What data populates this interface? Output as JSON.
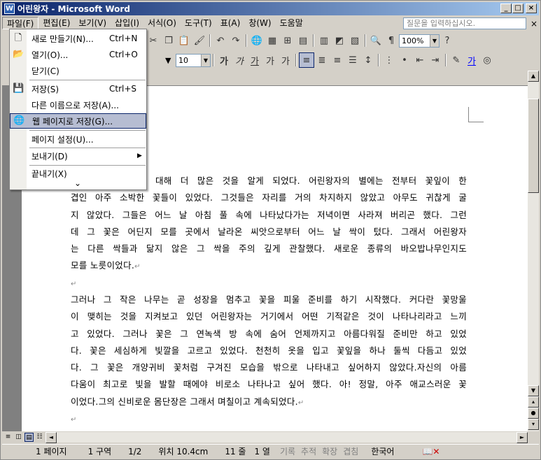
{
  "window": {
    "title": "어린왕자 - Microsoft Word"
  },
  "menubar": {
    "items": [
      "파일(F)",
      "편집(E)",
      "보기(V)",
      "삽입(I)",
      "서식(O)",
      "도구(T)",
      "표(A)",
      "창(W)",
      "도움말"
    ],
    "help_placeholder": "질문을 입력하십시오."
  },
  "toolbar": {
    "zoom": "100%",
    "font_size": "10"
  },
  "file_menu": {
    "new": {
      "label": "새로 만들기(N)...",
      "shortcut": "Ctrl+N"
    },
    "open": {
      "label": "열기(O)...",
      "shortcut": "Ctrl+O"
    },
    "close": {
      "label": "닫기(C)"
    },
    "save": {
      "label": "저장(S)",
      "shortcut": "Ctrl+S"
    },
    "save_as": {
      "label": "다른 이름으로 저장(A)..."
    },
    "save_web": {
      "label": "웹 페이지로 저장(G)..."
    },
    "page_setup": {
      "label": "페이지 설정(U)..."
    },
    "send": {
      "label": "보내기(D)"
    },
    "exit": {
      "label": "끝내기(X)"
    },
    "expand": "⌄"
  },
  "document": {
    "para1_lines": [
      "에 대해 더 많은 것을 알게 되었다. 어린왕자의 별에는 전부터 꽃잎이 한",
      "겹인 아주 소박한 꽃들이 있었다. 그것들은 자리를 거의 차지하지 않았고 아무도 귀찮게 굴",
      "지 않았다. 그들은 어느 날 아침 풀 속에 나타났다가는 저녁이면 사라져 버리곤 했다. 그런",
      "데 그 꽃은 어딘지 모를 곳에서 날라온 씨앗으로부터 어느 날 싹이 텄다. 그래서 어린왕자",
      "는 다른 싹들과 닮지 않은 그 싹을 주의 깊게 관찰했다. 새로운 종류의 바오밥나무인지도",
      "모를 노릇이었다."
    ],
    "para2_lines": [
      "그러나 그 작은 나무는 곧 성장을 멈추고 꽃을 피울 준비를 하기 시작했다. 커다란 꽃망울",
      "이 맺히는 것을 지켜보고 있던 어린왕자는 거기에서 어떤 기적같은 것이 나타나리라고 느끼",
      "고 있었다. 그러나 꽃은 그 연녹색 방 속에 숨어 언제까지고 아름다워질 준비만 하고 있었",
      "다. 꽃은 세심하게 빛깔을 고르고 있었다. 천천히 옷을 입고 꽃잎을 하나 둘씩 다듬고 있었",
      "다. 그 꽃은 개양귀비 꽃처럼 구겨진 모습을 밖으로 나타내고 싶어하지 않았다.자신의 아름",
      "다움이 최고로 빛을 발할 때에야 비로소 나타나고 싶어 했다. 아! 정말, 아주 애교스러운 꽃",
      "이었다.그의 신비로운 몸단장은 그래서 며칠이고 계속되었다."
    ]
  },
  "statusbar": {
    "page": "1 페이지",
    "section": "1 구역",
    "pages": "1/2",
    "position": "위치 10.4cm",
    "line": "11 줄",
    "column": "1 열",
    "rec": "기록",
    "trk": "추적",
    "ext": "확장",
    "ovr": "겹침",
    "lang": "한국어"
  }
}
